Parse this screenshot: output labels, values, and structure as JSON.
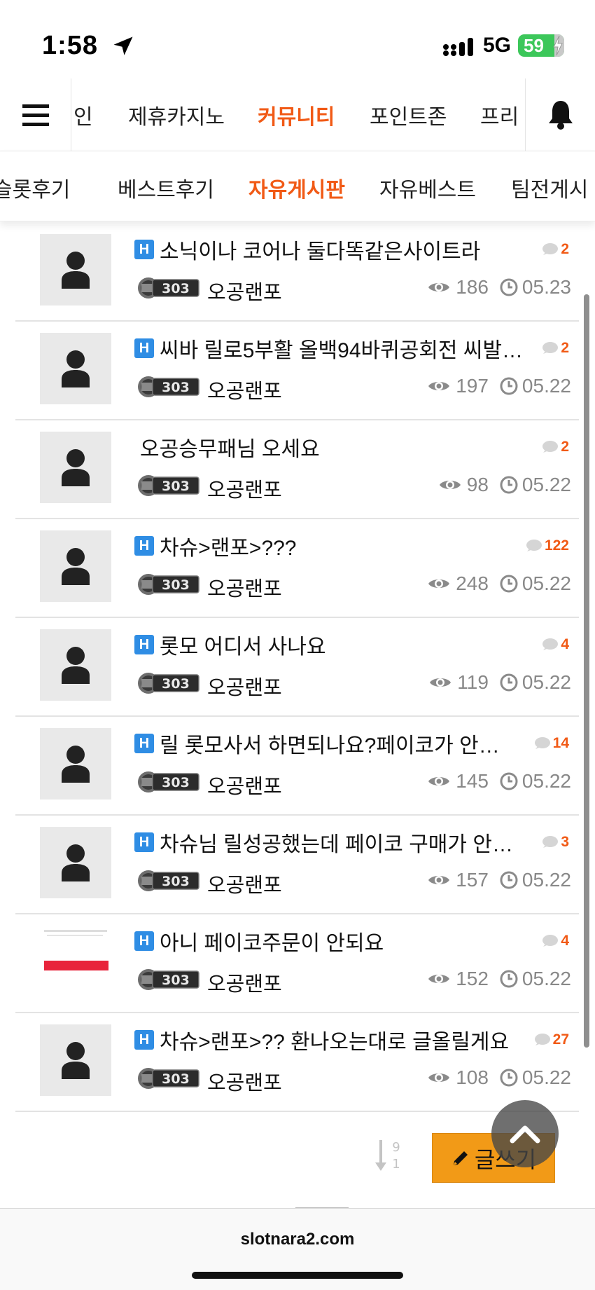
{
  "status_bar": {
    "time": "1:58",
    "network": "5G",
    "battery": "59"
  },
  "main_nav": {
    "tabs": [
      {
        "label": "인",
        "active": false
      },
      {
        "label": "제휴카지노",
        "active": false
      },
      {
        "label": "커뮤니티",
        "active": true
      },
      {
        "label": "포인트존",
        "active": false
      },
      {
        "label": "프리",
        "active": false
      }
    ]
  },
  "sub_nav": {
    "tabs": [
      {
        "label": "슬롯후기",
        "active": false
      },
      {
        "label": "베스트후기",
        "active": false
      },
      {
        "label": "자유게시판",
        "active": true
      },
      {
        "label": "자유베스트",
        "active": false
      },
      {
        "label": "팀전게시",
        "active": false
      }
    ]
  },
  "posts": [
    {
      "title": "소닉이나 코어나 둘다똑같은사이트라",
      "badge": "H",
      "comments": "2",
      "level": "303",
      "author": "오공랜포",
      "views": "186",
      "date": "05.23"
    },
    {
      "title": "씨바 릴로5부활 올백94바퀴공회전 씨발…",
      "badge": "H",
      "comments": "2",
      "level": "303",
      "author": "오공랜포",
      "views": "197",
      "date": "05.22"
    },
    {
      "title": "오공승무패님 오세요",
      "badge": "",
      "comments": "2",
      "level": "303",
      "author": "오공랜포",
      "views": "98",
      "date": "05.22"
    },
    {
      "title": "차슈>랜포>???",
      "badge": "H",
      "comments": "122",
      "level": "303",
      "author": "오공랜포",
      "views": "248",
      "date": "05.22"
    },
    {
      "title": "롯모 어디서 사나요",
      "badge": "H",
      "comments": "4",
      "level": "303",
      "author": "오공랜포",
      "views": "119",
      "date": "05.22"
    },
    {
      "title": "릴 롯모사서 하면되나요?페이코가 안…",
      "badge": "H",
      "comments": "14",
      "level": "303",
      "author": "오공랜포",
      "views": "145",
      "date": "05.22"
    },
    {
      "title": "차슈님 릴성공했는데 페이코 구매가 안…",
      "badge": "H",
      "comments": "3",
      "level": "303",
      "author": "오공랜포",
      "views": "157",
      "date": "05.22"
    },
    {
      "title": "아니 페이코주문이 안되요",
      "badge": "H",
      "comments": "4",
      "level": "303",
      "author": "오공랜포",
      "views": "152",
      "date": "05.22"
    },
    {
      "title": "차슈>랜포>?? 환나오는대로 글올릴게요",
      "badge": "H",
      "comments": "27",
      "level": "303",
      "author": "오공랜포",
      "views": "108",
      "date": "05.22"
    }
  ],
  "controls": {
    "sort_digits": [
      "9",
      "1"
    ],
    "write_label": "글쓰기"
  },
  "browser": {
    "url": "slotnara2.com"
  },
  "colors": {
    "accent": "#f15a16",
    "badge_blue": "#2f8de4",
    "write_button": "#f29a17"
  }
}
